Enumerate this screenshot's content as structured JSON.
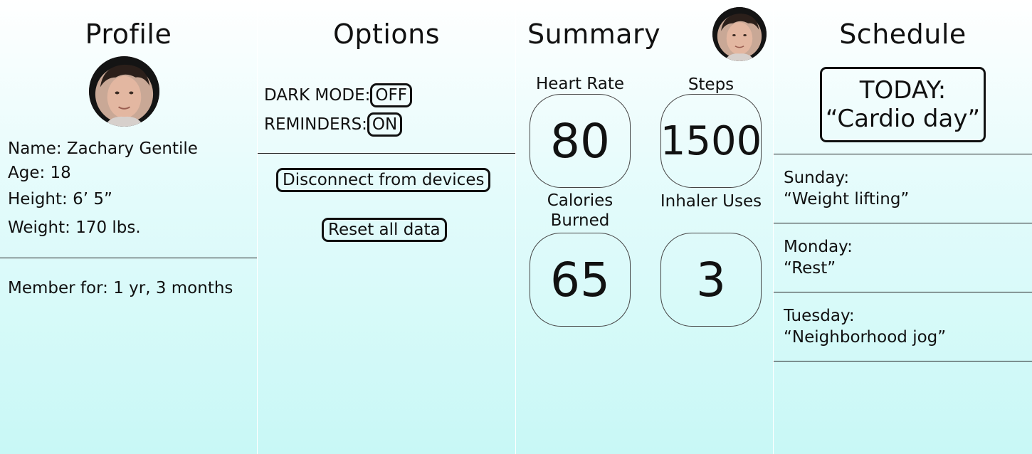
{
  "profile": {
    "title": "Profile",
    "name": "Name: Zachary Gentile",
    "age": "Age: 18",
    "height": "Height: 6’ 5”",
    "weight": "Weight: 170 lbs.",
    "member": "Member for: 1 yr, 3 months"
  },
  "options": {
    "title": "Options",
    "dark_mode_label": "DARK MODE:",
    "dark_mode_value": "OFF",
    "reminders_label": "REMINDERS:",
    "reminders_value": "ON",
    "disconnect_label": "Disconnect from devices",
    "reset_label": "Reset all data"
  },
  "summary": {
    "title": "Summary",
    "stats": [
      {
        "label": "Heart Rate",
        "value": "80"
      },
      {
        "label": "Steps",
        "value": "1500"
      },
      {
        "label": "Calories Burned",
        "value": "65"
      },
      {
        "label": "Inhaler Uses",
        "value": "3"
      }
    ]
  },
  "schedule": {
    "title": "Schedule",
    "today_label": "TODAY:",
    "today_value": "“Cardio day”",
    "days": [
      {
        "day": "Sunday:",
        "activity": "“Weight lifting”"
      },
      {
        "day": "Monday:",
        "activity": "“Rest”"
      },
      {
        "day": "Tuesday:",
        "activity": "“Neighborhood jog”"
      }
    ]
  },
  "icons": {
    "avatar": "user-avatar-photo"
  },
  "colors": {
    "background_top": "#ffffff",
    "background_bottom": "#c8f8f6",
    "text": "#111111"
  }
}
